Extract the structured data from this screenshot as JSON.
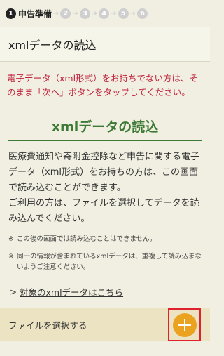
{
  "steps": {
    "current_number": "1",
    "current_label": "申告準備",
    "others": [
      "2",
      "3",
      "4",
      "5",
      "6"
    ]
  },
  "page_title": "xmlデータの読込",
  "notice": "電子データ（xml形式）をお持ちでない方は、そのまま「次へ」ボタンをタップしてください。",
  "section": {
    "heading": "xmlデータの読込",
    "description": "医療費通知や寄附金控除など申告に関する電子データ（xml形式）をお持ちの方は、この画面で読み込むことができます。",
    "usage": "ご利用の方は、ファイルを選択してデータを読み込んでください。",
    "notes": [
      {
        "mark": "※",
        "text": "この後の画面では読み込むことはできません。"
      },
      {
        "mark": "※",
        "text": "同一の情報が含まれているxmlデータは、重複して読み込まないようご注意ください。"
      }
    ],
    "link_text": "対象のxmlデータはこちら"
  },
  "file_bar": {
    "label": "ファイルを選択する"
  },
  "colors": {
    "background": "#f1efe1",
    "notice": "#c0243e",
    "accent_green": "#3d7a36",
    "file_bar": "#ece3c3",
    "add_button": "#eba221",
    "highlight": "#e0202f"
  }
}
